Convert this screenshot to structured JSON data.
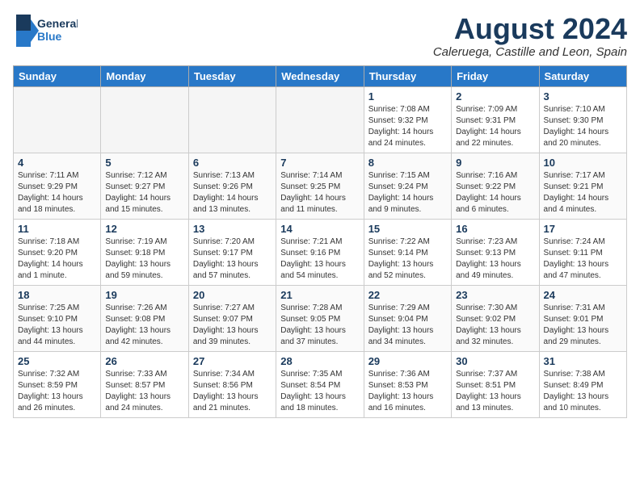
{
  "header": {
    "logo_general": "General",
    "logo_blue": "Blue",
    "month_year": "August 2024",
    "location": "Caleruega, Castille and Leon, Spain"
  },
  "days_of_week": [
    "Sunday",
    "Monday",
    "Tuesday",
    "Wednesday",
    "Thursday",
    "Friday",
    "Saturday"
  ],
  "weeks": [
    [
      {
        "day": "",
        "info": ""
      },
      {
        "day": "",
        "info": ""
      },
      {
        "day": "",
        "info": ""
      },
      {
        "day": "",
        "info": ""
      },
      {
        "day": "1",
        "info": "Sunrise: 7:08 AM\nSunset: 9:32 PM\nDaylight: 14 hours and 24 minutes."
      },
      {
        "day": "2",
        "info": "Sunrise: 7:09 AM\nSunset: 9:31 PM\nDaylight: 14 hours and 22 minutes."
      },
      {
        "day": "3",
        "info": "Sunrise: 7:10 AM\nSunset: 9:30 PM\nDaylight: 14 hours and 20 minutes."
      }
    ],
    [
      {
        "day": "4",
        "info": "Sunrise: 7:11 AM\nSunset: 9:29 PM\nDaylight: 14 hours and 18 minutes."
      },
      {
        "day": "5",
        "info": "Sunrise: 7:12 AM\nSunset: 9:27 PM\nDaylight: 14 hours and 15 minutes."
      },
      {
        "day": "6",
        "info": "Sunrise: 7:13 AM\nSunset: 9:26 PM\nDaylight: 14 hours and 13 minutes."
      },
      {
        "day": "7",
        "info": "Sunrise: 7:14 AM\nSunset: 9:25 PM\nDaylight: 14 hours and 11 minutes."
      },
      {
        "day": "8",
        "info": "Sunrise: 7:15 AM\nSunset: 9:24 PM\nDaylight: 14 hours and 9 minutes."
      },
      {
        "day": "9",
        "info": "Sunrise: 7:16 AM\nSunset: 9:22 PM\nDaylight: 14 hours and 6 minutes."
      },
      {
        "day": "10",
        "info": "Sunrise: 7:17 AM\nSunset: 9:21 PM\nDaylight: 14 hours and 4 minutes."
      }
    ],
    [
      {
        "day": "11",
        "info": "Sunrise: 7:18 AM\nSunset: 9:20 PM\nDaylight: 14 hours and 1 minute."
      },
      {
        "day": "12",
        "info": "Sunrise: 7:19 AM\nSunset: 9:18 PM\nDaylight: 13 hours and 59 minutes."
      },
      {
        "day": "13",
        "info": "Sunrise: 7:20 AM\nSunset: 9:17 PM\nDaylight: 13 hours and 57 minutes."
      },
      {
        "day": "14",
        "info": "Sunrise: 7:21 AM\nSunset: 9:16 PM\nDaylight: 13 hours and 54 minutes."
      },
      {
        "day": "15",
        "info": "Sunrise: 7:22 AM\nSunset: 9:14 PM\nDaylight: 13 hours and 52 minutes."
      },
      {
        "day": "16",
        "info": "Sunrise: 7:23 AM\nSunset: 9:13 PM\nDaylight: 13 hours and 49 minutes."
      },
      {
        "day": "17",
        "info": "Sunrise: 7:24 AM\nSunset: 9:11 PM\nDaylight: 13 hours and 47 minutes."
      }
    ],
    [
      {
        "day": "18",
        "info": "Sunrise: 7:25 AM\nSunset: 9:10 PM\nDaylight: 13 hours and 44 minutes."
      },
      {
        "day": "19",
        "info": "Sunrise: 7:26 AM\nSunset: 9:08 PM\nDaylight: 13 hours and 42 minutes."
      },
      {
        "day": "20",
        "info": "Sunrise: 7:27 AM\nSunset: 9:07 PM\nDaylight: 13 hours and 39 minutes."
      },
      {
        "day": "21",
        "info": "Sunrise: 7:28 AM\nSunset: 9:05 PM\nDaylight: 13 hours and 37 minutes."
      },
      {
        "day": "22",
        "info": "Sunrise: 7:29 AM\nSunset: 9:04 PM\nDaylight: 13 hours and 34 minutes."
      },
      {
        "day": "23",
        "info": "Sunrise: 7:30 AM\nSunset: 9:02 PM\nDaylight: 13 hours and 32 minutes."
      },
      {
        "day": "24",
        "info": "Sunrise: 7:31 AM\nSunset: 9:01 PM\nDaylight: 13 hours and 29 minutes."
      }
    ],
    [
      {
        "day": "25",
        "info": "Sunrise: 7:32 AM\nSunset: 8:59 PM\nDaylight: 13 hours and 26 minutes."
      },
      {
        "day": "26",
        "info": "Sunrise: 7:33 AM\nSunset: 8:57 PM\nDaylight: 13 hours and 24 minutes."
      },
      {
        "day": "27",
        "info": "Sunrise: 7:34 AM\nSunset: 8:56 PM\nDaylight: 13 hours and 21 minutes."
      },
      {
        "day": "28",
        "info": "Sunrise: 7:35 AM\nSunset: 8:54 PM\nDaylight: 13 hours and 18 minutes."
      },
      {
        "day": "29",
        "info": "Sunrise: 7:36 AM\nSunset: 8:53 PM\nDaylight: 13 hours and 16 minutes."
      },
      {
        "day": "30",
        "info": "Sunrise: 7:37 AM\nSunset: 8:51 PM\nDaylight: 13 hours and 13 minutes."
      },
      {
        "day": "31",
        "info": "Sunrise: 7:38 AM\nSunset: 8:49 PM\nDaylight: 13 hours and 10 minutes."
      }
    ]
  ]
}
